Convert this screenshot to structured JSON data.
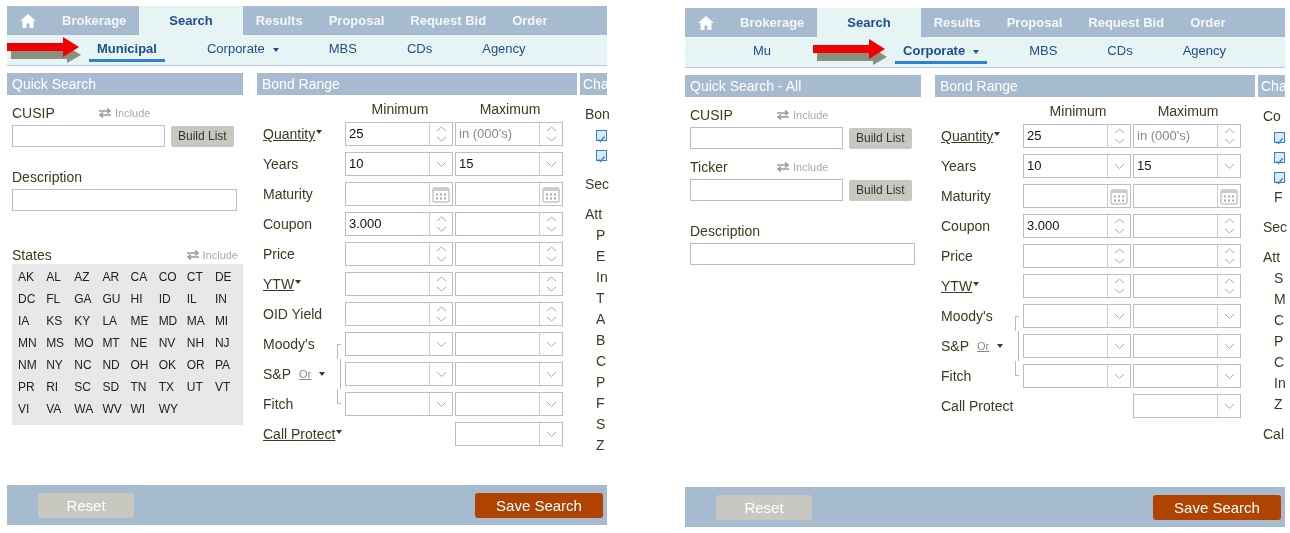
{
  "panels": [
    {
      "tabs": [
        {
          "kind": "home",
          "selected": false
        },
        {
          "kind": "text",
          "label": "Brokerage",
          "selected": false
        },
        {
          "kind": "text",
          "label": "Search",
          "selected": true
        },
        {
          "kind": "text",
          "label": "Results",
          "selected": false
        },
        {
          "kind": "text",
          "label": "Proposal",
          "selected": false
        },
        {
          "kind": "text",
          "label": "Request Bid",
          "selected": false
        },
        {
          "kind": "text",
          "label": "Order",
          "selected": false
        }
      ],
      "subtabs": [
        {
          "label": "Municipal",
          "selected": true,
          "dropdown": false
        },
        {
          "label": "Corporate",
          "selected": false,
          "dropdown": true
        },
        {
          "label": "MBS",
          "selected": false,
          "dropdown": false
        },
        {
          "label": "CDs",
          "selected": false,
          "dropdown": false
        },
        {
          "label": "Agency",
          "selected": false,
          "dropdown": false
        }
      ],
      "quick_search": {
        "title": "Quick Search",
        "fields": [
          {
            "label": "CUSIP",
            "include": "Include",
            "button": "Build List"
          },
          {
            "label": "Description"
          }
        ],
        "states": {
          "label": "States",
          "include": "Include",
          "codes": [
            "AK",
            "AL",
            "AZ",
            "AR",
            "CA",
            "CO",
            "CT",
            "DE",
            "DC",
            "FL",
            "GA",
            "GU",
            "HI",
            "ID",
            "IL",
            "IN",
            "IA",
            "KS",
            "KY",
            "LA",
            "ME",
            "MD",
            "MA",
            "MI",
            "MN",
            "MS",
            "MO",
            "MT",
            "NE",
            "NV",
            "NH",
            "NJ",
            "NM",
            "NY",
            "NC",
            "ND",
            "OH",
            "OK",
            "OR",
            "PA",
            "PR",
            "RI",
            "SC",
            "SD",
            "TN",
            "TX",
            "UT",
            "VT",
            "VI",
            "VA",
            "WA",
            "WV",
            "WI",
            "WY"
          ]
        }
      },
      "bond_range": {
        "title": "Bond Range",
        "min_label": "Minimum",
        "max_label": "Maximum",
        "rows": [
          {
            "label": "Quantity",
            "link": true,
            "dropdown": true,
            "bracket": false,
            "min": {
              "kind": "spin",
              "value": "25"
            },
            "max": {
              "kind": "spin",
              "placeholder": "in (000's)"
            }
          },
          {
            "label": "Years",
            "link": false,
            "dropdown": false,
            "bracket": false,
            "min": {
              "kind": "select",
              "value": "10"
            },
            "max": {
              "kind": "select",
              "value": "15"
            }
          },
          {
            "label": "Maturity",
            "link": false,
            "dropdown": false,
            "bracket": false,
            "min": {
              "kind": "date"
            },
            "max": {
              "kind": "date"
            }
          },
          {
            "label": "Coupon",
            "link": false,
            "dropdown": false,
            "bracket": false,
            "min": {
              "kind": "spin",
              "value": "3.000"
            },
            "max": {
              "kind": "spin"
            }
          },
          {
            "label": "Price",
            "link": false,
            "dropdown": false,
            "bracket": false,
            "min": {
              "kind": "spin"
            },
            "max": {
              "kind": "spin"
            }
          },
          {
            "label": "YTW",
            "link": true,
            "dropdown": true,
            "bracket": false,
            "min": {
              "kind": "spin"
            },
            "max": {
              "kind": "spin"
            }
          },
          {
            "label": "OID Yield",
            "link": false,
            "dropdown": false,
            "bracket": false,
            "min": {
              "kind": "spin"
            },
            "max": {
              "kind": "spin"
            }
          },
          {
            "label": "Moody's",
            "link": false,
            "dropdown": false,
            "bracket": true,
            "min": {
              "kind": "select"
            },
            "max": {
              "kind": "select"
            }
          },
          {
            "label": "S&P",
            "or": "Or",
            "link": false,
            "dropdown": false,
            "bracket": true,
            "min": {
              "kind": "select"
            },
            "max": {
              "kind": "select"
            }
          },
          {
            "label": "Fitch",
            "link": false,
            "dropdown": false,
            "bracket": true,
            "min": {
              "kind": "select"
            },
            "max": {
              "kind": "select"
            }
          },
          {
            "label": "Call Protect",
            "link": true,
            "dropdown": true,
            "bracket": false,
            "max": {
              "kind": "select"
            }
          }
        ]
      },
      "column_3": {
        "title": "Cha",
        "items": [
          {
            "kind": "label",
            "text": "Bon"
          },
          {
            "kind": "checkbox",
            "checked": true
          },
          {
            "kind": "checkbox",
            "checked": true
          },
          {
            "kind": "label",
            "text": "Sec"
          },
          {
            "kind": "label",
            "text": "Att"
          },
          {
            "kind": "option",
            "text": "P"
          },
          {
            "kind": "option",
            "text": "E"
          },
          {
            "kind": "option",
            "text": "In"
          },
          {
            "kind": "option",
            "text": "T"
          },
          {
            "kind": "option",
            "text": "A"
          },
          {
            "kind": "option",
            "text": "B"
          },
          {
            "kind": "option",
            "text": "C"
          },
          {
            "kind": "option",
            "text": "P"
          },
          {
            "kind": "option",
            "text": "F"
          },
          {
            "kind": "option",
            "text": "S"
          },
          {
            "kind": "option",
            "text": "Z"
          }
        ]
      },
      "footer": {
        "reset": "Reset",
        "save": "Save Search"
      }
    },
    {
      "tabs": [
        {
          "kind": "home",
          "selected": false
        },
        {
          "kind": "text",
          "label": "Brokerage",
          "selected": false
        },
        {
          "kind": "text",
          "label": "Search",
          "selected": true
        },
        {
          "kind": "text",
          "label": "Results",
          "selected": false
        },
        {
          "kind": "text",
          "label": "Proposal",
          "selected": false
        },
        {
          "kind": "text",
          "label": "Request Bid",
          "selected": false
        },
        {
          "kind": "text",
          "label": "Order",
          "selected": false
        }
      ],
      "subtabs": [
        {
          "label": "Mu",
          "selected": false,
          "dropdown": false
        },
        {
          "label": "Corporate",
          "selected": true,
          "dropdown": true
        },
        {
          "label": "MBS",
          "selected": false,
          "dropdown": false
        },
        {
          "label": "CDs",
          "selected": false,
          "dropdown": false
        },
        {
          "label": "Agency",
          "selected": false,
          "dropdown": false
        }
      ],
      "quick_search": {
        "title": "Quick Search - All",
        "fields": [
          {
            "label": "CUSIP",
            "include": "Include",
            "button": "Build List"
          },
          {
            "label": "Ticker",
            "include": "Include",
            "button": "Build List"
          },
          {
            "label": "Description"
          }
        ]
      },
      "bond_range": {
        "title": "Bond Range",
        "min_label": "Minimum",
        "max_label": "Maximum",
        "rows": [
          {
            "label": "Quantity",
            "link": true,
            "dropdown": true,
            "bracket": false,
            "min": {
              "kind": "spin",
              "value": "25"
            },
            "max": {
              "kind": "spin",
              "placeholder": "in (000's)"
            }
          },
          {
            "label": "Years",
            "link": false,
            "dropdown": false,
            "bracket": false,
            "min": {
              "kind": "select",
              "value": "10"
            },
            "max": {
              "kind": "select",
              "value": "15"
            }
          },
          {
            "label": "Maturity",
            "link": false,
            "dropdown": false,
            "bracket": false,
            "min": {
              "kind": "date"
            },
            "max": {
              "kind": "date"
            }
          },
          {
            "label": "Coupon",
            "link": false,
            "dropdown": false,
            "bracket": false,
            "min": {
              "kind": "spin",
              "value": "3.000"
            },
            "max": {
              "kind": "spin"
            }
          },
          {
            "label": "Price",
            "link": false,
            "dropdown": false,
            "bracket": false,
            "min": {
              "kind": "spin"
            },
            "max": {
              "kind": "spin"
            }
          },
          {
            "label": "YTW",
            "link": true,
            "dropdown": true,
            "bracket": false,
            "min": {
              "kind": "spin"
            },
            "max": {
              "kind": "spin"
            }
          },
          {
            "label": "Moody's",
            "link": false,
            "dropdown": false,
            "bracket": true,
            "min": {
              "kind": "select"
            },
            "max": {
              "kind": "select"
            }
          },
          {
            "label": "S&P",
            "or": "Or",
            "link": false,
            "dropdown": false,
            "bracket": true,
            "min": {
              "kind": "select"
            },
            "max": {
              "kind": "select"
            }
          },
          {
            "label": "Fitch",
            "link": false,
            "dropdown": false,
            "bracket": true,
            "min": {
              "kind": "select"
            },
            "max": {
              "kind": "select"
            }
          },
          {
            "label": "Call Protect",
            "link": false,
            "dropdown": false,
            "bracket": false,
            "max": {
              "kind": "select"
            }
          }
        ]
      },
      "column_3": {
        "title": "Cha",
        "items": [
          {
            "kind": "label",
            "text": "Co"
          },
          {
            "kind": "checkbox",
            "checked": true
          },
          {
            "kind": "checkbox",
            "checked": true
          },
          {
            "kind": "checkbox",
            "checked": true
          },
          {
            "kind": "option",
            "text": "F"
          },
          {
            "kind": "label",
            "text": "Sec"
          },
          {
            "kind": "label",
            "text": "Att"
          },
          {
            "kind": "option",
            "text": "S"
          },
          {
            "kind": "option",
            "text": "M"
          },
          {
            "kind": "option",
            "text": "C"
          },
          {
            "kind": "option",
            "text": "P"
          },
          {
            "kind": "option",
            "text": "C"
          },
          {
            "kind": "option",
            "text": "In"
          },
          {
            "kind": "option",
            "text": "Z"
          },
          {
            "kind": "label",
            "text": "Cal"
          }
        ]
      },
      "footer": {
        "reset": "Reset",
        "save": "Save Search"
      }
    }
  ]
}
